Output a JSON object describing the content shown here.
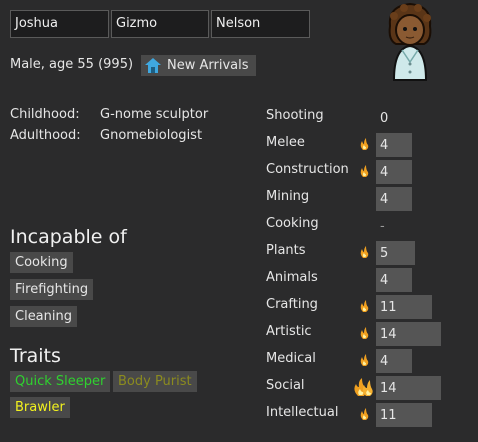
{
  "names": {
    "first": "Joshua",
    "nick": "Gizmo",
    "last": "Nelson"
  },
  "bio": {
    "summary": "Male, age 55 (995)",
    "faction_label": "New Arrivals",
    "childhood_label": "Childhood:",
    "childhood_value": "G-nome sculptor",
    "adulthood_label": "Adulthood:",
    "adulthood_value": "Gnomebiologist"
  },
  "incapable": {
    "title": "Incapable of",
    "items": [
      "Cooking",
      "Firefighting",
      "Cleaning"
    ]
  },
  "traits": {
    "title": "Traits",
    "items": [
      {
        "label": "Quick Sleeper",
        "color": "#2fd12f"
      },
      {
        "label": "Body Purist",
        "color": "#8b8b1f"
      },
      {
        "label": "Brawler",
        "color": "#f2f21e"
      }
    ]
  },
  "skills": [
    {
      "name": "Shooting",
      "value": "0",
      "level": 0,
      "passion": 0
    },
    {
      "name": "Melee",
      "value": "4",
      "level": 4,
      "passion": 1
    },
    {
      "name": "Construction",
      "value": "4",
      "level": 4,
      "passion": 1
    },
    {
      "name": "Mining",
      "value": "4",
      "level": 4,
      "passion": 0
    },
    {
      "name": "Cooking",
      "value": "-",
      "level": 0,
      "passion": 0
    },
    {
      "name": "Plants",
      "value": "5",
      "level": 5,
      "passion": 1
    },
    {
      "name": "Animals",
      "value": "4",
      "level": 4,
      "passion": 0
    },
    {
      "name": "Crafting",
      "value": "11",
      "level": 11,
      "passion": 1
    },
    {
      "name": "Artistic",
      "value": "14",
      "level": 14,
      "passion": 1
    },
    {
      "name": "Medical",
      "value": "4",
      "level": 4,
      "passion": 1
    },
    {
      "name": "Social",
      "value": "14",
      "level": 14,
      "passion": 2
    },
    {
      "name": "Intellectual",
      "value": "11",
      "level": 11,
      "passion": 1
    }
  ],
  "colors": {
    "background": "#2b2b2c",
    "tag_bg": "#494949",
    "faction_icon": "#3fa8e0",
    "passion": "#f0a020"
  }
}
